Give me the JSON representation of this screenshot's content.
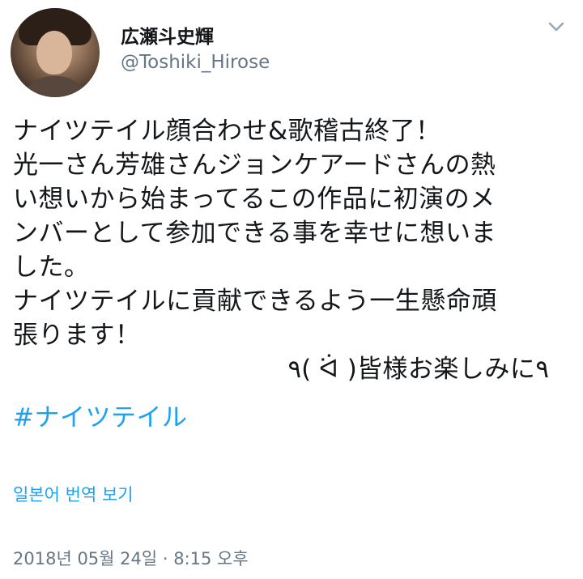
{
  "author": {
    "display_name": "広瀬斗史輝",
    "handle": "@Toshiki_Hirose"
  },
  "tweet": {
    "lines": [
      "ナイツテイル顔合わせ&歌稽古終了！",
      "光一さん芳雄さんジョンケアードさんの熱",
      "い想いから始まってるこの作品に初演のメ",
      "ンバーとして参加できる事を幸せに想いま",
      "した。",
      "ナイツテイルに貢献できるよう一生懸命頑",
      "張ります！",
      "٩( ᐛ )皆様お楽しみに٩"
    ],
    "hashtag": "#ナイツテイル"
  },
  "translate_link": "일본어 번역 보기",
  "timestamp": "2018년 05월 24일 · 8:15 오후",
  "icons": {
    "menu": "chevron-down-icon",
    "avatar": "profile-photo"
  },
  "colors": {
    "link": "#1da1f2",
    "secondary_text": "#657786",
    "primary_text": "#14171a"
  }
}
